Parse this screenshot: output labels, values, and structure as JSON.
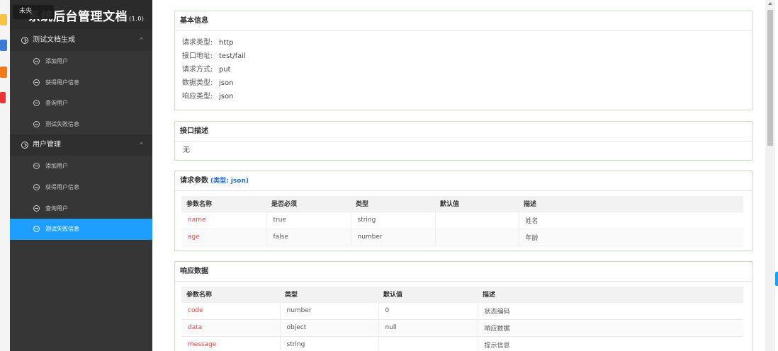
{
  "sidebar": {
    "title": "系统后台管理文档",
    "version": "(1.0)",
    "tooltip": "未央",
    "groups": [
      {
        "label": "测试文档生成",
        "items": [
          {
            "label": "添加用户"
          },
          {
            "label": "获得用户信息"
          },
          {
            "label": "查询用户"
          },
          {
            "label": "测试失败信息"
          }
        ]
      },
      {
        "label": "用户管理",
        "items": [
          {
            "label": "添加用户"
          },
          {
            "label": "获得用户信息"
          },
          {
            "label": "查询用户"
          },
          {
            "label": "测试失败信息"
          }
        ]
      }
    ]
  },
  "basic": {
    "title": "基本信息",
    "rows": [
      {
        "k": "请求类型:",
        "v": "http"
      },
      {
        "k": "接口地址:",
        "v": "test/fail"
      },
      {
        "k": "请求方式:",
        "v": "put"
      },
      {
        "k": "数据类型:",
        "v": "json"
      },
      {
        "k": "响应类型:",
        "v": "json"
      }
    ]
  },
  "desc": {
    "title": "接口描述",
    "text": "无"
  },
  "request": {
    "title": "请求参数",
    "subtitle": "(类型: json)",
    "headers": [
      "参数名称",
      "是否必须",
      "类型",
      "默认值",
      "描述"
    ],
    "rows": [
      [
        "name",
        "true",
        "string",
        "",
        "姓名"
      ],
      [
        "age",
        "false",
        "number",
        "",
        "年龄"
      ]
    ]
  },
  "response": {
    "title": "响应数据",
    "headers": [
      "参数名称",
      "类型",
      "默认值",
      "描述"
    ],
    "rows": [
      [
        "code",
        "number",
        "0",
        "状态编码"
      ],
      [
        "data",
        "object",
        "null",
        "响应数据"
      ],
      [
        "message",
        "string",
        "",
        "提示信息"
      ]
    ]
  },
  "colors": {
    "accent": "#1e9fff",
    "sidebar": "#363636",
    "param_name": "#e84545",
    "card_border": "#c7e2c0"
  }
}
